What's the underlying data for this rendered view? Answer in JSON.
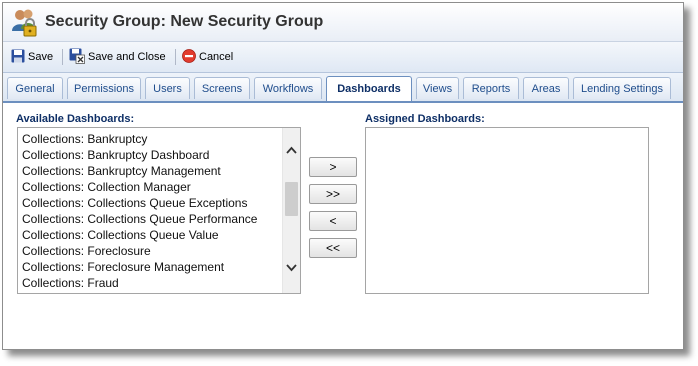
{
  "window": {
    "title": "Security Group: New Security Group"
  },
  "toolbar": {
    "save_label": "Save",
    "save_close_label": "Save and Close",
    "cancel_label": "Cancel"
  },
  "tabs": [
    {
      "label": "General"
    },
    {
      "label": "Permissions"
    },
    {
      "label": "Users"
    },
    {
      "label": "Screens"
    },
    {
      "label": "Workflows"
    },
    {
      "label": "Dashboards",
      "active": true
    },
    {
      "label": "Views"
    },
    {
      "label": "Reports"
    },
    {
      "label": "Areas"
    },
    {
      "label": "Lending Settings"
    }
  ],
  "available": {
    "label": "Available Dashboards:",
    "items": [
      "Collections: Bankruptcy",
      "Collections: Bankruptcy Dashboard",
      "Collections: Bankruptcy Management",
      "Collections: Collection Manager",
      "Collections: Collections Queue Exceptions",
      "Collections: Collections Queue Performance",
      "Collections: Collections Queue Value",
      "Collections: Foreclosure",
      "Collections: Foreclosure Management",
      "Collections: Fraud"
    ]
  },
  "assigned": {
    "label": "Assigned Dashboards:",
    "items": []
  },
  "move_buttons": {
    "add": ">",
    "add_all": ">>",
    "remove": "<",
    "remove_all": "<<"
  },
  "colors": {
    "accent": "#0e2f66",
    "tab_text": "#1f4d8c",
    "tab_border": "#6c8fbf"
  }
}
